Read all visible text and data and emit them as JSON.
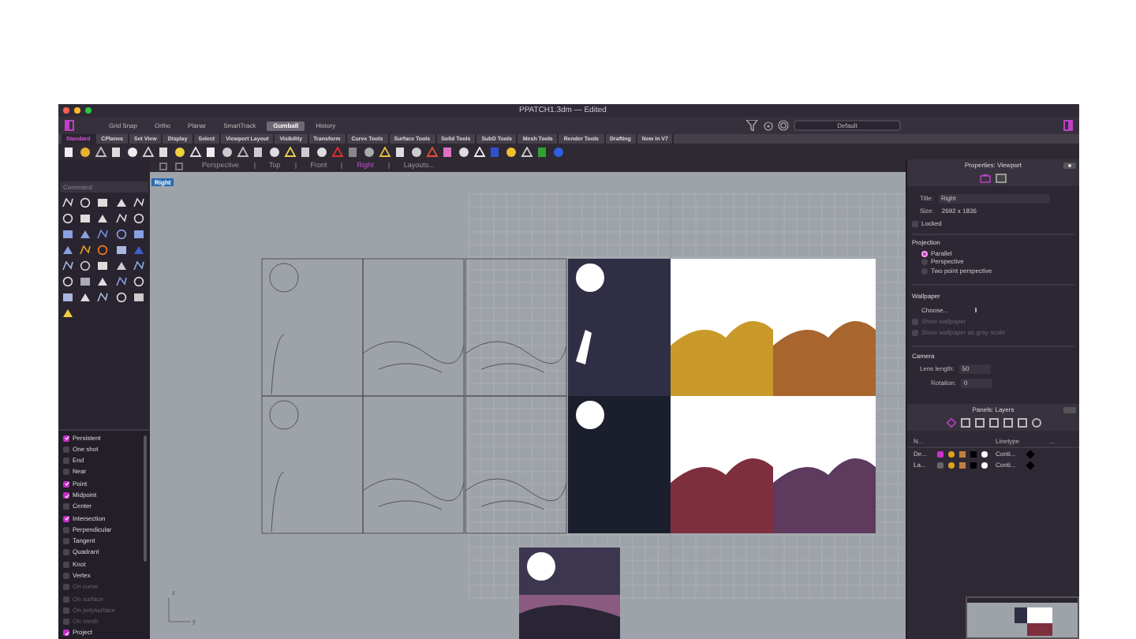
{
  "window": {
    "title": "PPATCH1.3dm — Edited"
  },
  "toggles": [
    {
      "label": "Grid Snap",
      "selected": false
    },
    {
      "label": "Ortho",
      "selected": false
    },
    {
      "label": "Planar",
      "selected": false
    },
    {
      "label": "SmartTrack",
      "selected": false
    },
    {
      "label": "Gumball",
      "selected": true
    },
    {
      "label": "History",
      "selected": false
    }
  ],
  "layer_state": {
    "value": "Default"
  },
  "tool_tabs": [
    {
      "label": "Standard",
      "selected": true
    },
    {
      "label": "CPlanes",
      "selected": false
    },
    {
      "label": "Set View",
      "selected": false
    },
    {
      "label": "Display",
      "selected": false
    },
    {
      "label": "Select",
      "selected": false
    },
    {
      "label": "Viewport Layout",
      "selected": false
    },
    {
      "label": "Visibility",
      "selected": false
    },
    {
      "label": "Transform",
      "selected": false
    },
    {
      "label": "Curve Tools",
      "selected": false
    },
    {
      "label": "Surface Tools",
      "selected": false
    },
    {
      "label": "Solid Tools",
      "selected": false
    },
    {
      "label": "SubD Tools",
      "selected": false
    },
    {
      "label": "Mesh Tools",
      "selected": false
    },
    {
      "label": "Render Tools",
      "selected": false
    },
    {
      "label": "Drafting",
      "selected": false
    },
    {
      "label": "New in V7",
      "selected": false
    }
  ],
  "viewport_tabs": [
    {
      "label": "Perspective",
      "selected": false
    },
    {
      "label": "Top",
      "selected": false
    },
    {
      "label": "Front",
      "selected": false
    },
    {
      "label": "Right",
      "selected": true
    },
    {
      "label": "Layouts...",
      "selected": false
    }
  ],
  "command": {
    "placeholder": "Command"
  },
  "viewport": {
    "label": "Right",
    "axes": [
      "z",
      "y"
    ]
  },
  "osnaps": [
    {
      "label": "Persistent",
      "checked": true,
      "disabled": false
    },
    {
      "label": "One shot",
      "checked": false,
      "disabled": false
    },
    {
      "label": "End",
      "checked": false,
      "disabled": false
    },
    {
      "label": "Near",
      "checked": false,
      "disabled": false
    },
    {
      "label": "Point",
      "checked": true,
      "disabled": false
    },
    {
      "label": "Midpoint",
      "checked": true,
      "disabled": false
    },
    {
      "label": "Center",
      "checked": false,
      "disabled": false
    },
    {
      "label": "Intersection",
      "checked": true,
      "disabled": false
    },
    {
      "label": "Perpendicular",
      "checked": false,
      "disabled": false
    },
    {
      "label": "Tangent",
      "checked": false,
      "disabled": false
    },
    {
      "label": "Quadrant",
      "checked": false,
      "disabled": false
    },
    {
      "label": "Knot",
      "checked": false,
      "disabled": false
    },
    {
      "label": "Vertex",
      "checked": false,
      "disabled": false
    },
    {
      "label": "On curve",
      "checked": false,
      "disabled": true
    },
    {
      "label": "On surface",
      "checked": false,
      "disabled": true
    },
    {
      "label": "On polysurface",
      "checked": false,
      "disabled": true
    },
    {
      "label": "On mesh",
      "checked": false,
      "disabled": true
    },
    {
      "label": "Project",
      "checked": true,
      "disabled": false
    }
  ],
  "properties": {
    "header": "Properties: Viewport",
    "title_label": "Title:",
    "title_value": "Right",
    "size_label": "Size:",
    "size_value": "2692 x 1836",
    "locked": {
      "label": "Locked",
      "checked": false
    },
    "projection": {
      "heading": "Projection",
      "options": [
        {
          "label": "Parallel",
          "selected": true
        },
        {
          "label": "Perspective",
          "selected": false
        },
        {
          "label": "Two point perspective",
          "selected": false
        }
      ]
    },
    "wallpaper": {
      "heading": "Wallpaper",
      "choose": "Choose...",
      "options": [
        {
          "label": "Show wallpaper",
          "checked": false,
          "disabled": true
        },
        {
          "label": "Show wallpaper as gray scale",
          "checked": false,
          "disabled": true
        }
      ]
    },
    "camera": {
      "heading": "Camera",
      "lens_label": "Lens length:",
      "lens_value": "50",
      "rotation_label": "Rotation:",
      "rotation_value": "0"
    }
  },
  "layers": {
    "header": "Panels: Layers",
    "columns": [
      "N...",
      "Linetype",
      "..."
    ],
    "rows": [
      {
        "name": "De...",
        "current": true,
        "linetype": "Conti..."
      },
      {
        "name": "La...",
        "current": false,
        "linetype": "Conti..."
      }
    ]
  }
}
